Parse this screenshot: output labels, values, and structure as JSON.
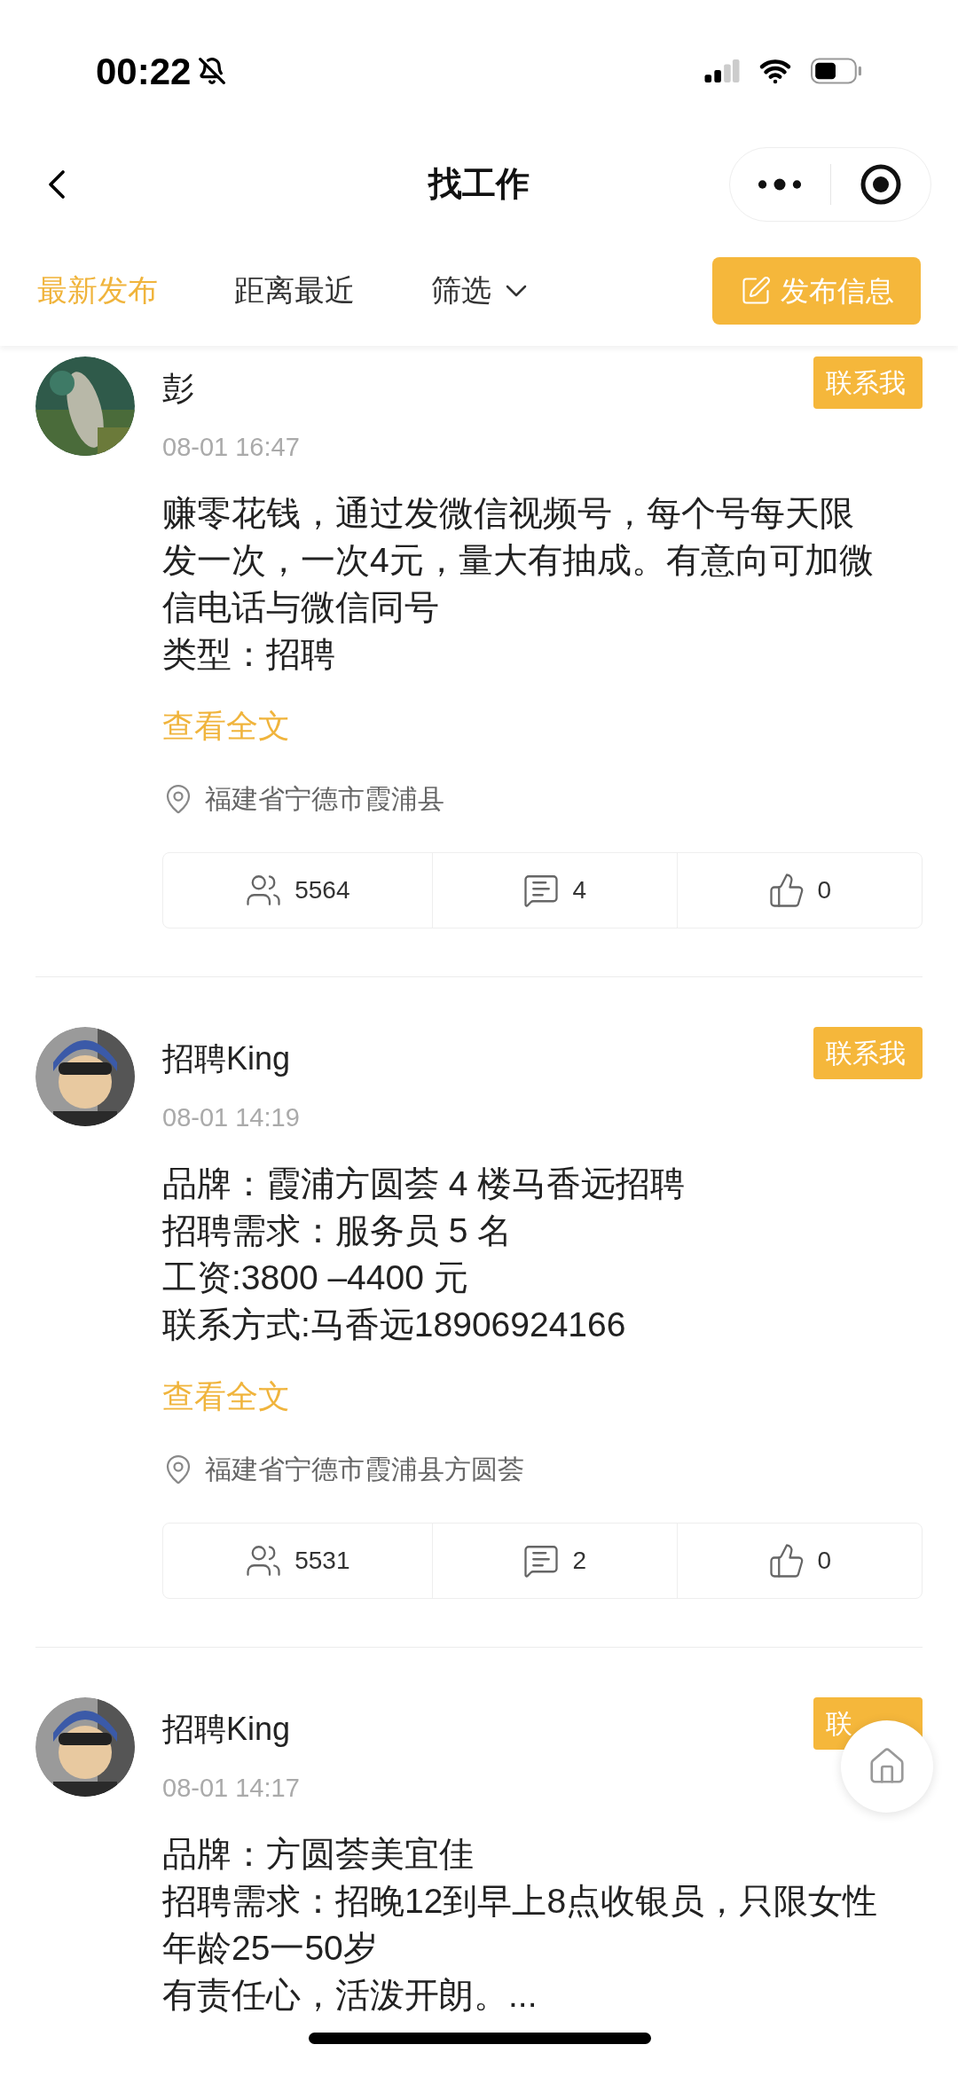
{
  "status_bar": {
    "time": "00:22"
  },
  "nav": {
    "title": "找工作"
  },
  "tabs": [
    {
      "label": "最新发布",
      "selected": true,
      "kind": "plain"
    },
    {
      "label": "距离最近",
      "selected": false,
      "kind": "plain"
    },
    {
      "label": "筛选",
      "selected": false,
      "kind": "dropdown"
    }
  ],
  "post_button": "发布信息",
  "posts": [
    {
      "name": "彭",
      "time": "08-01 16:47",
      "contact": "联系我",
      "paragraphs": [
        "赚零花钱，通过发微信视频号，每个号每天限发一次，一次4元，量大有抽成。有意向可加微信电话与微信同号",
        "类型：招聘"
      ],
      "more": "查看全文",
      "location": "福建省宁德市霞浦县",
      "views": "5564",
      "comments": "4",
      "likes": "0"
    },
    {
      "name": "招聘King",
      "time": "08-01 14:19",
      "contact": "联系我",
      "paragraphs": [
        "品牌：霞浦方圆荟 4 楼马香远招聘",
        "招聘需求：服务员 5 名",
        "工资:3800 –4400 元",
        "联系方式:马香远18906924166"
      ],
      "more": "查看全文",
      "location": "福建省宁德市霞浦县方圆荟",
      "views": "5531",
      "comments": "2",
      "likes": "0"
    },
    {
      "name": "招聘King",
      "time": "08-01 14:17",
      "contact": "联",
      "paragraphs": [
        "品牌：方圆荟美宜佳",
        "招聘需求：招晚12到早上8点收银员，只限女性",
        "年龄25一50岁",
        "有责任心，活泼开朗。..."
      ]
    }
  ]
}
